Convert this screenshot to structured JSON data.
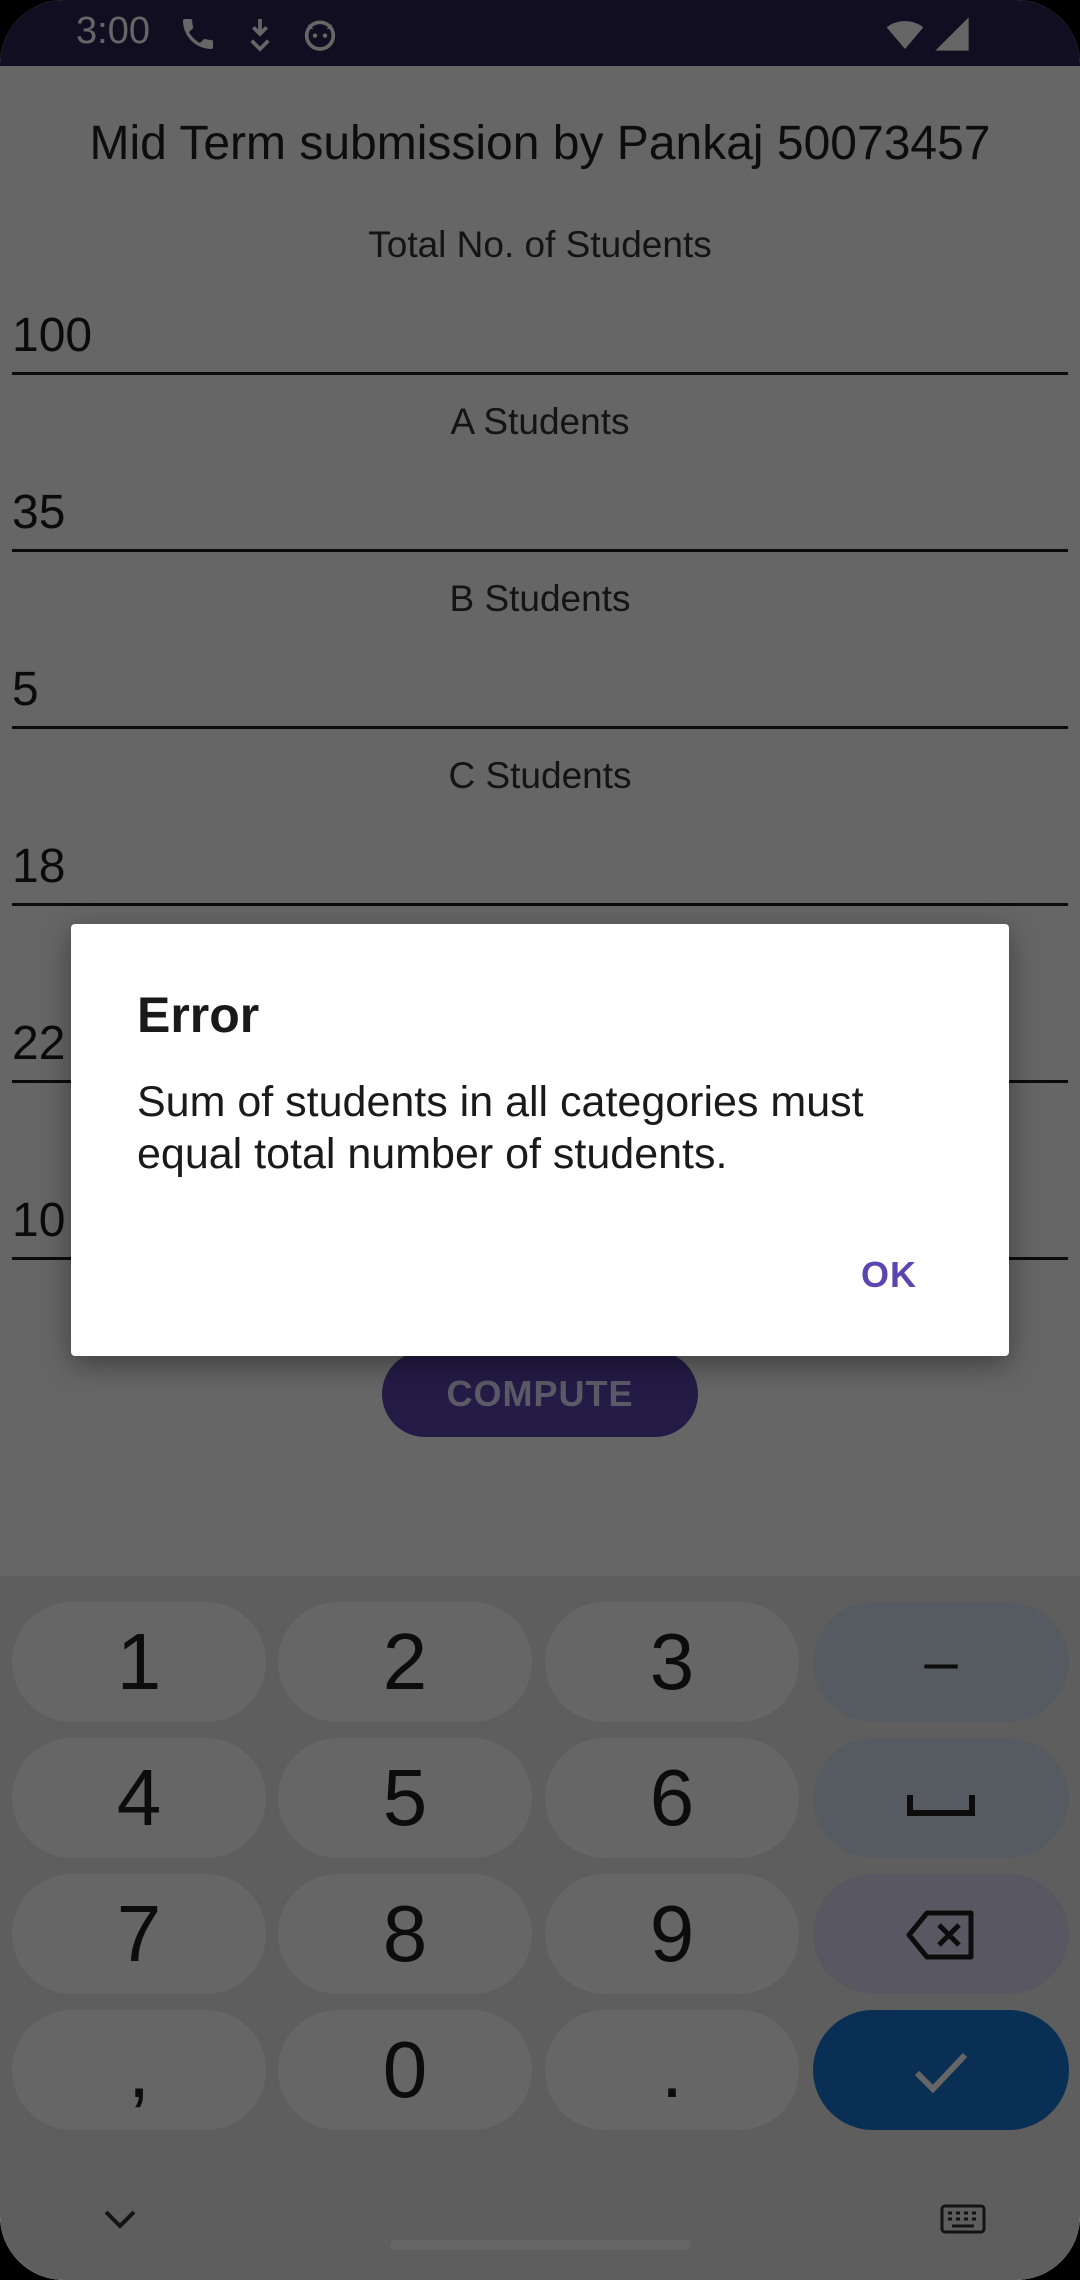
{
  "status_bar": {
    "time": "3:00",
    "left_icons": [
      "phone-icon",
      "download-icon",
      "cat-face-icon"
    ],
    "right_icons": [
      "wifi-icon",
      "signal-icon"
    ]
  },
  "app": {
    "title": "Mid Term submission by Pankaj 50073457",
    "fields": [
      {
        "label": "Total No. of Students",
        "value": "100"
      },
      {
        "label": "A Students",
        "value": "35"
      },
      {
        "label": "B Students",
        "value": "5"
      },
      {
        "label": "C Students",
        "value": "18"
      },
      {
        "label": "",
        "value": "22"
      },
      {
        "label": "",
        "value": "10"
      }
    ],
    "compute_label": "COMPUTE"
  },
  "dialog": {
    "title": "Error",
    "message": "Sum of students in all categories must equal total number of students.",
    "ok_label": "OK"
  },
  "keyboard": {
    "rows": [
      [
        "1",
        "2",
        "3",
        "–"
      ],
      [
        "4",
        "5",
        "6",
        "␣"
      ],
      [
        "7",
        "8",
        "9",
        "⌫"
      ],
      [
        ",",
        "0",
        ".",
        "✓"
      ]
    ]
  },
  "colors": {
    "status_bar": "#2f2354",
    "accent": "#5b45b0",
    "enter_key": "#1976d2",
    "func_key": "#d4e4f2"
  }
}
